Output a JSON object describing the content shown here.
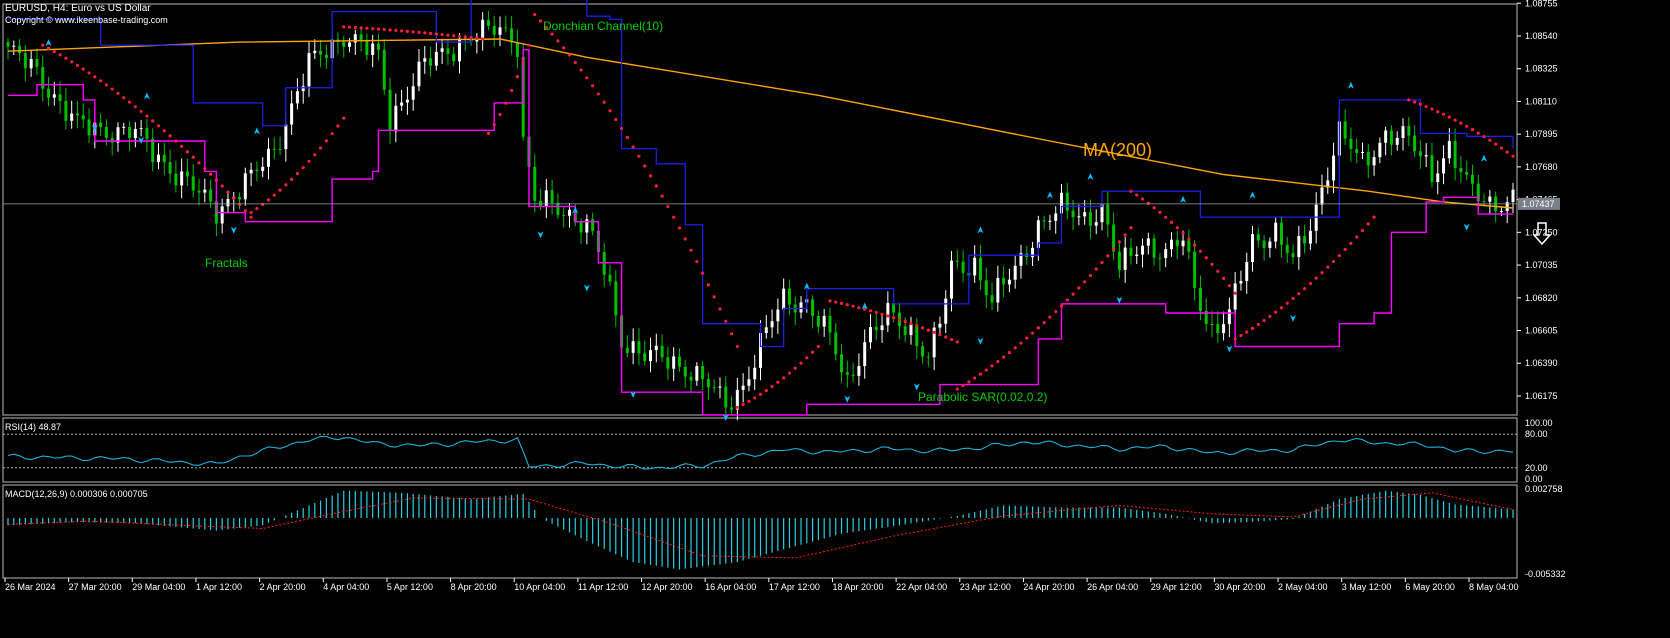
{
  "header": {
    "symbol_line": "EURUSD, H4:  Euro vs US Dollar",
    "copyright": "Copyright © www.ikeenbase-trading.com"
  },
  "colors": {
    "background": "#000000",
    "candle_up": "#ffffff",
    "candle_down": "#00c000",
    "ma": "#ffa500",
    "donchian": "#1e1ee6",
    "lower_band": "#ff00ff",
    "psar": "#ff1e3c",
    "fractals": "#00bfff",
    "rsi": "#1ab2d6",
    "macd_hist": "#28cfe0",
    "macd_signal": "#ff2020",
    "label_green": "#00d000",
    "price_tag_bg": "#7a7f88",
    "grid_text": "#ffffff",
    "separator": "#b8b8b8"
  },
  "icons": {
    "price_direction": "down-arrow-icon"
  },
  "chart_data": [
    {
      "type": "candlestick",
      "panel": "main",
      "symbol": "EURUSD",
      "timeframe": "H4",
      "ylim": [
        1.0605,
        1.0875
      ],
      "y_ticks": [
        "1.08755",
        "1.08540",
        "1.08325",
        "1.08110",
        "1.07895",
        "1.07680",
        "1.07465",
        "1.07250",
        "1.07035",
        "1.06820",
        "1.06605",
        "1.06390",
        "1.06175"
      ],
      "current_price": "1.07437",
      "x_labels": [
        "26 Mar 2024",
        "27 Mar 20:00",
        "29 Mar 04:00",
        "1 Apr 12:00",
        "2 Apr 20:00",
        "4 Apr 04:00",
        "5 Apr 12:00",
        "8 Apr 20:00",
        "10 Apr 04:00",
        "11 Apr 12:00",
        "12 Apr 20:00",
        "16 Apr 04:00",
        "17 Apr 12:00",
        "18 Apr 20:00",
        "22 Apr 04:00",
        "23 Apr 12:00",
        "24 Apr 20:00",
        "26 Apr 04:00",
        "29 Apr 12:00",
        "30 Apr 20:00",
        "2 May 04:00",
        "3 May 12:00",
        "6 May 20:00",
        "8 May 04:00"
      ],
      "close_anchors": [
        [
          0,
          1.0845
        ],
        [
          5,
          1.083
        ],
        [
          12,
          1.0795
        ],
        [
          22,
          1.079
        ],
        [
          30,
          1.076
        ],
        [
          36,
          1.074
        ],
        [
          42,
          1.076
        ],
        [
          46,
          1.078
        ],
        [
          52,
          1.0835
        ],
        [
          58,
          1.0855
        ],
        [
          64,
          1.084
        ],
        [
          66,
          1.08
        ],
        [
          72,
          1.0835
        ],
        [
          78,
          1.085
        ],
        [
          82,
          1.0855
        ],
        [
          85,
          1.086
        ],
        [
          88,
          1.085
        ],
        [
          89,
          1.0785
        ],
        [
          91,
          1.0745
        ],
        [
          96,
          1.074
        ],
        [
          100,
          1.073
        ],
        [
          103,
          1.07
        ],
        [
          106,
          1.0655
        ],
        [
          110,
          1.0645
        ],
        [
          114,
          1.064
        ],
        [
          118,
          1.0635
        ],
        [
          121,
          1.0625
        ],
        [
          124,
          1.061
        ],
        [
          127,
          1.0625
        ],
        [
          131,
          1.066
        ],
        [
          134,
          1.068
        ],
        [
          138,
          1.068
        ],
        [
          142,
          1.0655
        ],
        [
          145,
          1.0625
        ],
        [
          148,
          1.0655
        ],
        [
          152,
          1.067
        ],
        [
          156,
          1.066
        ],
        [
          159,
          1.0645
        ],
        [
          161,
          1.0665
        ],
        [
          163,
          1.07
        ],
        [
          167,
          1.0705
        ],
        [
          170,
          1.068
        ],
        [
          174,
          1.07
        ],
        [
          178,
          1.073
        ],
        [
          182,
          1.074
        ],
        [
          186,
          1.0735
        ],
        [
          189,
          1.074
        ],
        [
          192,
          1.07
        ],
        [
          196,
          1.072
        ],
        [
          200,
          1.071
        ],
        [
          203,
          1.072
        ],
        [
          205,
          1.069
        ],
        [
          208,
          1.066
        ],
        [
          211,
          1.067
        ],
        [
          215,
          1.072
        ],
        [
          219,
          1.0725
        ],
        [
          222,
          1.0705
        ],
        [
          225,
          1.073
        ],
        [
          227,
          1.0755
        ],
        [
          230,
          1.079
        ],
        [
          234,
          1.077
        ],
        [
          238,
          1.079
        ],
        [
          242,
          1.0785
        ],
        [
          246,
          1.0765
        ],
        [
          249,
          1.078
        ],
        [
          252,
          1.0755
        ],
        [
          256,
          1.0745
        ],
        [
          260,
          1.0745
        ]
      ],
      "ma": {
        "name": "MA(200)",
        "values": [
          [
            0,
            1.0844
          ],
          [
            40,
            1.085
          ],
          [
            85,
            1.0852
          ],
          [
            100,
            1.084
          ],
          [
            140,
            1.0815
          ],
          [
            180,
            1.0785
          ],
          [
            210,
            1.0763
          ],
          [
            235,
            1.0752
          ],
          [
            248,
            1.0745
          ],
          [
            260,
            1.0741
          ]
        ]
      },
      "donchian": {
        "name": "Donchian Channel(10)",
        "upper": [
          [
            0,
            1.0865
          ],
          [
            12,
            1.0865
          ],
          [
            16,
            1.0848
          ],
          [
            32,
            1.081
          ],
          [
            44,
            1.0795
          ],
          [
            48,
            1.082
          ],
          [
            56,
            1.087
          ],
          [
            74,
            1.085
          ],
          [
            80,
            1.088
          ],
          [
            96,
            1.0878
          ],
          [
            100,
            1.0867
          ],
          [
            104,
            1.0865
          ],
          [
            106,
            1.078
          ],
          [
            112,
            1.077
          ],
          [
            117,
            1.073
          ],
          [
            120,
            1.0665
          ],
          [
            130,
            1.065
          ],
          [
            134,
            1.0675
          ],
          [
            138,
            1.0688
          ],
          [
            150,
            1.0688
          ],
          [
            153,
            1.0678
          ],
          [
            164,
            1.0678
          ],
          [
            166,
            1.071
          ],
          [
            178,
            1.0718
          ],
          [
            182,
            1.0742
          ],
          [
            189,
            1.0752
          ],
          [
            206,
            1.0735
          ],
          [
            222,
            1.0735
          ],
          [
            230,
            1.0812
          ],
          [
            242,
            1.0812
          ],
          [
            244,
            1.079
          ],
          [
            252,
            1.0788
          ],
          [
            260,
            1.078
          ]
        ],
        "lower": [
          [
            0,
            1.0815
          ],
          [
            5,
            1.0822
          ],
          [
            13,
            1.0812
          ],
          [
            15,
            1.0785
          ],
          [
            34,
            1.0765
          ],
          [
            36,
            1.0738
          ],
          [
            41,
            1.0732
          ],
          [
            53,
            1.0732
          ],
          [
            56,
            1.076
          ],
          [
            63,
            1.0765
          ],
          [
            64,
            1.0792
          ],
          [
            80,
            1.0792
          ],
          [
            84,
            1.081
          ],
          [
            89,
            1.0845
          ],
          [
            90,
            1.0742
          ],
          [
            98,
            1.0732
          ],
          [
            102,
            1.0705
          ],
          [
            106,
            1.062
          ],
          [
            112,
            1.062
          ],
          [
            120,
            1.0605
          ],
          [
            135,
            1.0605
          ],
          [
            138,
            1.0612
          ],
          [
            160,
            1.0612
          ],
          [
            161,
            1.0625
          ],
          [
            178,
            1.0655
          ],
          [
            182,
            1.0678
          ],
          [
            192,
            1.0678
          ],
          [
            200,
            1.0672
          ],
          [
            208,
            1.0672
          ],
          [
            212,
            1.065
          ],
          [
            226,
            1.065
          ],
          [
            230,
            1.0665
          ],
          [
            236,
            1.0672
          ],
          [
            239,
            1.0725
          ],
          [
            245,
            1.0745
          ],
          [
            248,
            1.0748
          ],
          [
            254,
            1.0737
          ],
          [
            260,
            1.0737
          ]
        ]
      },
      "psar_label": "Parabolic SAR(0.02,0.2)",
      "fractals_label": "Fractals",
      "psar_segments": [
        [
          [
            6,
            1.0848
          ],
          [
            42,
            1.0735
          ]
        ],
        [
          [
            42,
            1.0738
          ],
          [
            58,
            1.08
          ]
        ],
        [
          [
            58,
            1.086
          ],
          [
            82,
            1.0852
          ]
        ],
        [
          [
            83,
            1.079
          ],
          [
            90,
            1.0848
          ]
        ],
        [
          [
            91,
            1.0868
          ],
          [
            126,
            1.065
          ]
        ],
        [
          [
            126,
            1.061
          ],
          [
            140,
            1.065
          ]
        ],
        [
          [
            142,
            1.068
          ],
          [
            164,
            1.0653
          ]
        ],
        [
          [
            164,
            1.0622
          ],
          [
            194,
            1.0728
          ]
        ],
        [
          [
            194,
            1.0752
          ],
          [
            212,
            1.0685
          ]
        ],
        [
          [
            212,
            1.0655
          ],
          [
            236,
            1.0735
          ]
        ],
        [
          [
            242,
            1.0812
          ],
          [
            260,
            1.0775
          ]
        ]
      ],
      "fractals_up": [
        [
          7,
          1.0848
        ],
        [
          24,
          1.0813
        ],
        [
          43,
          1.079
        ],
        [
          58,
          1.0887
        ],
        [
          83,
          1.0895
        ],
        [
          98,
          1.0738
        ],
        [
          138,
          1.0688
        ],
        [
          148,
          1.0675
        ],
        [
          168,
          1.0725
        ],
        [
          180,
          1.0748
        ],
        [
          187,
          1.076
        ],
        [
          203,
          1.0745
        ],
        [
          215,
          1.0748
        ],
        [
          232,
          1.082
        ],
        [
          255,
          1.0772
        ]
      ],
      "fractals_down": [
        [
          15,
          1.0795
        ],
        [
          23,
          1.0787
        ],
        [
          39,
          1.0728
        ],
        [
          92,
          1.0725
        ],
        [
          100,
          1.069
        ],
        [
          108,
          1.062
        ],
        [
          124,
          1.0605
        ],
        [
          145,
          1.0617
        ],
        [
          157,
          1.0625
        ],
        [
          168,
          1.0655
        ],
        [
          192,
          1.0682
        ],
        [
          211,
          1.065
        ],
        [
          222,
          1.067
        ],
        [
          252,
          1.073
        ]
      ]
    },
    {
      "type": "line",
      "panel": "rsi",
      "title": "RSI(14) 48.87",
      "ylim": [
        0,
        100
      ],
      "y_ticks": [
        "100.00",
        "80.00",
        "20.00",
        "0.00"
      ],
      "levels": [
        80,
        20
      ],
      "values": [
        [
          0,
          40
        ],
        [
          10,
          38
        ],
        [
          20,
          36
        ],
        [
          30,
          30
        ],
        [
          36,
          26
        ],
        [
          40,
          40
        ],
        [
          52,
          70
        ],
        [
          58,
          75
        ],
        [
          64,
          62
        ],
        [
          72,
          60
        ],
        [
          80,
          66
        ],
        [
          88,
          70
        ],
        [
          90,
          22
        ],
        [
          100,
          28
        ],
        [
          106,
          22
        ],
        [
          112,
          20
        ],
        [
          120,
          24
        ],
        [
          126,
          40
        ],
        [
          134,
          52
        ],
        [
          142,
          48
        ],
        [
          152,
          54
        ],
        [
          160,
          50
        ],
        [
          168,
          56
        ],
        [
          176,
          66
        ],
        [
          184,
          60
        ],
        [
          192,
          54
        ],
        [
          200,
          58
        ],
        [
          208,
          46
        ],
        [
          214,
          50
        ],
        [
          222,
          52
        ],
        [
          230,
          70
        ],
        [
          238,
          64
        ],
        [
          246,
          60
        ],
        [
          250,
          50
        ],
        [
          256,
          50
        ],
        [
          260,
          49
        ]
      ]
    },
    {
      "type": "bar",
      "panel": "macd",
      "title": "MACD(12,26,9) 0.000306 0.000705",
      "ylim": [
        -0.005332,
        0.002758
      ],
      "y_ticks": [
        "0.002758",
        "-0.005332"
      ],
      "histogram": [
        [
          0,
          -0.0007
        ],
        [
          12,
          -0.0004
        ],
        [
          22,
          -0.0005
        ],
        [
          36,
          -0.0012
        ],
        [
          44,
          -0.0007
        ],
        [
          52,
          0.0012
        ],
        [
          58,
          0.0026
        ],
        [
          68,
          0.0024
        ],
        [
          80,
          0.0018
        ],
        [
          89,
          0.0023
        ],
        [
          92,
          0.0
        ],
        [
          100,
          -0.0022
        ],
        [
          108,
          -0.0042
        ],
        [
          116,
          -0.0049
        ],
        [
          126,
          -0.0042
        ],
        [
          134,
          -0.003
        ],
        [
          144,
          -0.0015
        ],
        [
          154,
          -0.0007
        ],
        [
          164,
          0.0002
        ],
        [
          172,
          0.0012
        ],
        [
          182,
          0.001
        ],
        [
          192,
          0.001
        ],
        [
          200,
          0.0004
        ],
        [
          208,
          -0.0005
        ],
        [
          214,
          -0.0004
        ],
        [
          222,
          -0.0001
        ],
        [
          230,
          0.0018
        ],
        [
          238,
          0.0026
        ],
        [
          244,
          0.0022
        ],
        [
          250,
          0.0013
        ],
        [
          260,
          0.0008
        ]
      ],
      "signal": [
        [
          0,
          -0.0006
        ],
        [
          14,
          -0.0003
        ],
        [
          30,
          -0.0007
        ],
        [
          44,
          -0.001
        ],
        [
          56,
          0.0004
        ],
        [
          70,
          0.0019
        ],
        [
          90,
          0.0018
        ],
        [
          104,
          -0.0005
        ],
        [
          120,
          -0.0036
        ],
        [
          136,
          -0.0038
        ],
        [
          154,
          -0.0016
        ],
        [
          172,
          0.0002
        ],
        [
          192,
          0.0012
        ],
        [
          208,
          0.0004
        ],
        [
          222,
          0.0001
        ],
        [
          234,
          0.0018
        ],
        [
          246,
          0.0024
        ],
        [
          260,
          0.0008
        ]
      ]
    }
  ]
}
